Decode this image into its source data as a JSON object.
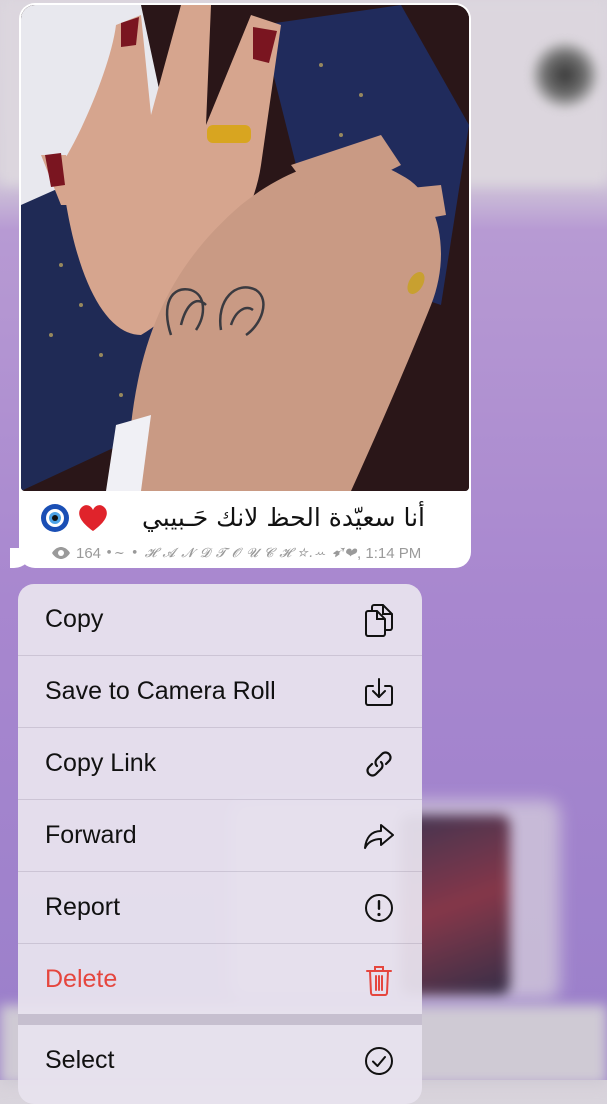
{
  "message": {
    "caption_text": "أنا سعيّدة الحظ لانك حَـبيبي",
    "caption_emojis": "❤️ 🧿",
    "views": "164",
    "signature": "•~ • 𝓗 𝓐 𝓝 𝓓  𝓣 𝓞 𝓤 𝓒 𝓗 ☆.ꕀ ➹❤",
    "time": "1:14 PM"
  },
  "menu": {
    "items": [
      {
        "label": "Copy",
        "icon": "copy-icon"
      },
      {
        "label": "Save to Camera Roll",
        "icon": "save-download-icon"
      },
      {
        "label": "Copy Link",
        "icon": "link-icon"
      },
      {
        "label": "Forward",
        "icon": "forward-arrow-icon"
      },
      {
        "label": "Report",
        "icon": "exclamation-circle-icon"
      },
      {
        "label": "Delete",
        "icon": "trash-icon"
      },
      {
        "label": "Select",
        "icon": "checkmark-circle-icon"
      }
    ]
  },
  "colors": {
    "destructive": "#e5463e",
    "menu_bg": "#e8e2ee",
    "chat_bg": "#a887cf"
  }
}
